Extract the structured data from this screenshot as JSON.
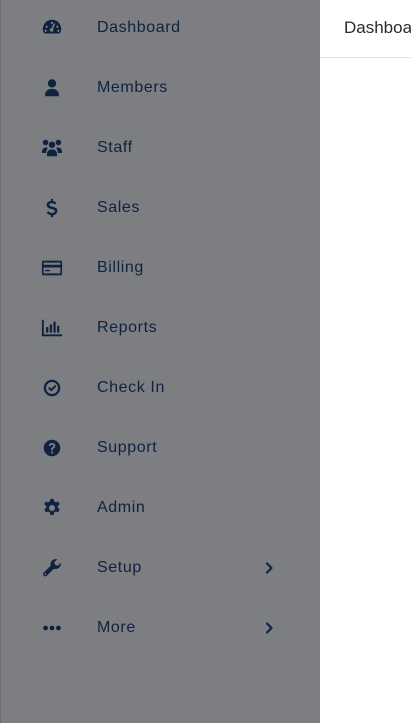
{
  "sidebar": {
    "background": "#7d7e82",
    "accent": "#0f2240",
    "items": [
      {
        "label": "Dashboard",
        "icon": "gauge-icon"
      },
      {
        "label": "Members",
        "icon": "user-icon"
      },
      {
        "label": "Staff",
        "icon": "users-icon"
      },
      {
        "label": "Sales",
        "icon": "dollar-icon"
      },
      {
        "label": "Billing",
        "icon": "credit-card-icon"
      },
      {
        "label": "Reports",
        "icon": "bar-chart-icon"
      },
      {
        "label": "Check In",
        "icon": "check-circle-icon"
      },
      {
        "label": "Support",
        "icon": "question-circle-icon"
      },
      {
        "label": "Admin",
        "icon": "gear-icon"
      },
      {
        "label": "Setup",
        "icon": "wrench-icon",
        "has_submenu": true
      },
      {
        "label": "More",
        "icon": "ellipsis-icon",
        "has_submenu": true
      }
    ]
  },
  "main": {
    "title": "Dashboard"
  }
}
